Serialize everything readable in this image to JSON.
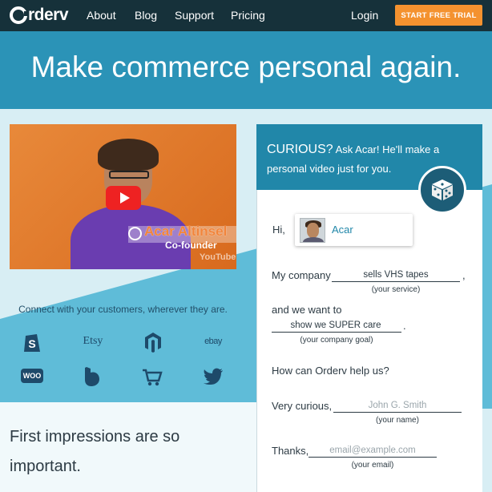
{
  "nav": {
    "logo_text": "rderv",
    "links": [
      "About",
      "Blog",
      "Support",
      "Pricing"
    ],
    "login": "Login",
    "cta": "START FREE TRIAL"
  },
  "hero": {
    "title": "Make commerce personal again."
  },
  "video": {
    "caption_name": "Acar Altinsel",
    "caption_role": "Co-founder",
    "watermark": "YouTube"
  },
  "connect": {
    "text": "Connect with your customers, wherever they are.",
    "brands": [
      "shopify-icon",
      "Etsy",
      "magento-icon",
      "ebay",
      "WOO",
      "bigcommerce-icon",
      "cart-icon",
      "twitter-icon"
    ]
  },
  "intro": {
    "text": "First impressions are so important."
  },
  "form": {
    "head_big": "CURIOUS?",
    "head_rest": " Ask Acar! He'll make a personal video just for you.",
    "hi_label": "Hi,",
    "recipient": "Acar",
    "company_label": "My company",
    "company_value": "sells VHS tapes",
    "company_comma": ",",
    "company_hint": "(your service)",
    "goal_label": "and we want to",
    "goal_value": "show we SUPER care",
    "goal_period": ".",
    "goal_hint": "(your company goal)",
    "question": "How can Orderv help us?",
    "name_label": "Very curious,",
    "name_placeholder": "John G. Smith",
    "name_hint": "(your name)",
    "email_label": "Thanks,",
    "email_placeholder": "email@example.com",
    "email_hint": "(your email)"
  }
}
